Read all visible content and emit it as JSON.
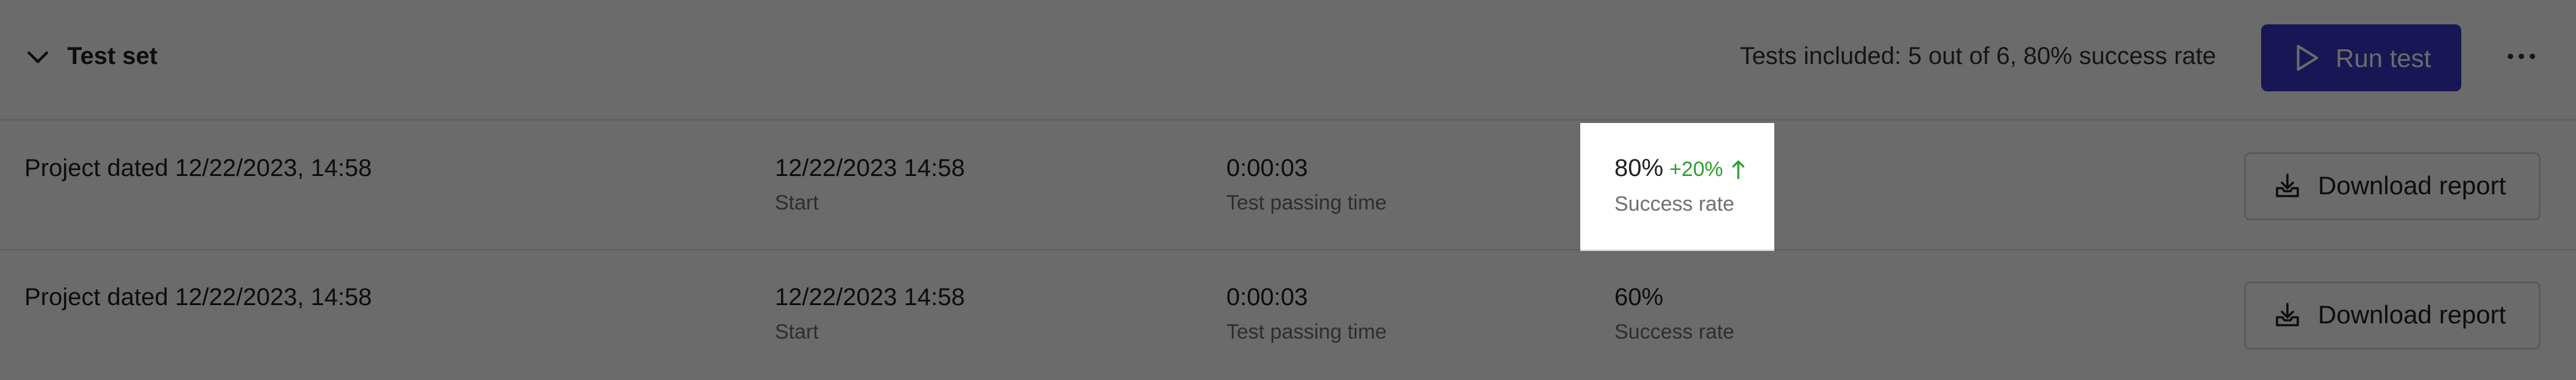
{
  "header": {
    "title": "Test set",
    "summary": "Tests included: 5 out of 6, 80% success rate",
    "run_label": "Run test",
    "icons": {
      "collapse": "chevron-down-icon",
      "run": "play-icon",
      "more": "more-horizontal-icon"
    }
  },
  "rows": [
    {
      "project": "Project dated 12/22/2023, 14:58",
      "start_value": "12/22/2023 14:58",
      "start_caption": "Start",
      "time_value": "0:00:03",
      "time_caption": "Test passing time",
      "rate_value": "80%",
      "rate_delta": "+20%",
      "rate_caption": "Success rate",
      "download_label": "Download report"
    },
    {
      "project": "Project dated 12/22/2023, 14:58",
      "start_value": "12/22/2023 14:58",
      "start_caption": "Start",
      "time_value": "0:00:03",
      "time_caption": "Test passing time",
      "rate_value": "60%",
      "rate_caption": "Success rate",
      "download_label": "Download report"
    }
  ],
  "colors": {
    "accent": "#3a36c9",
    "positive": "#2e9e2e",
    "dim_overlay": "rgba(0,0,0,0.58)"
  }
}
